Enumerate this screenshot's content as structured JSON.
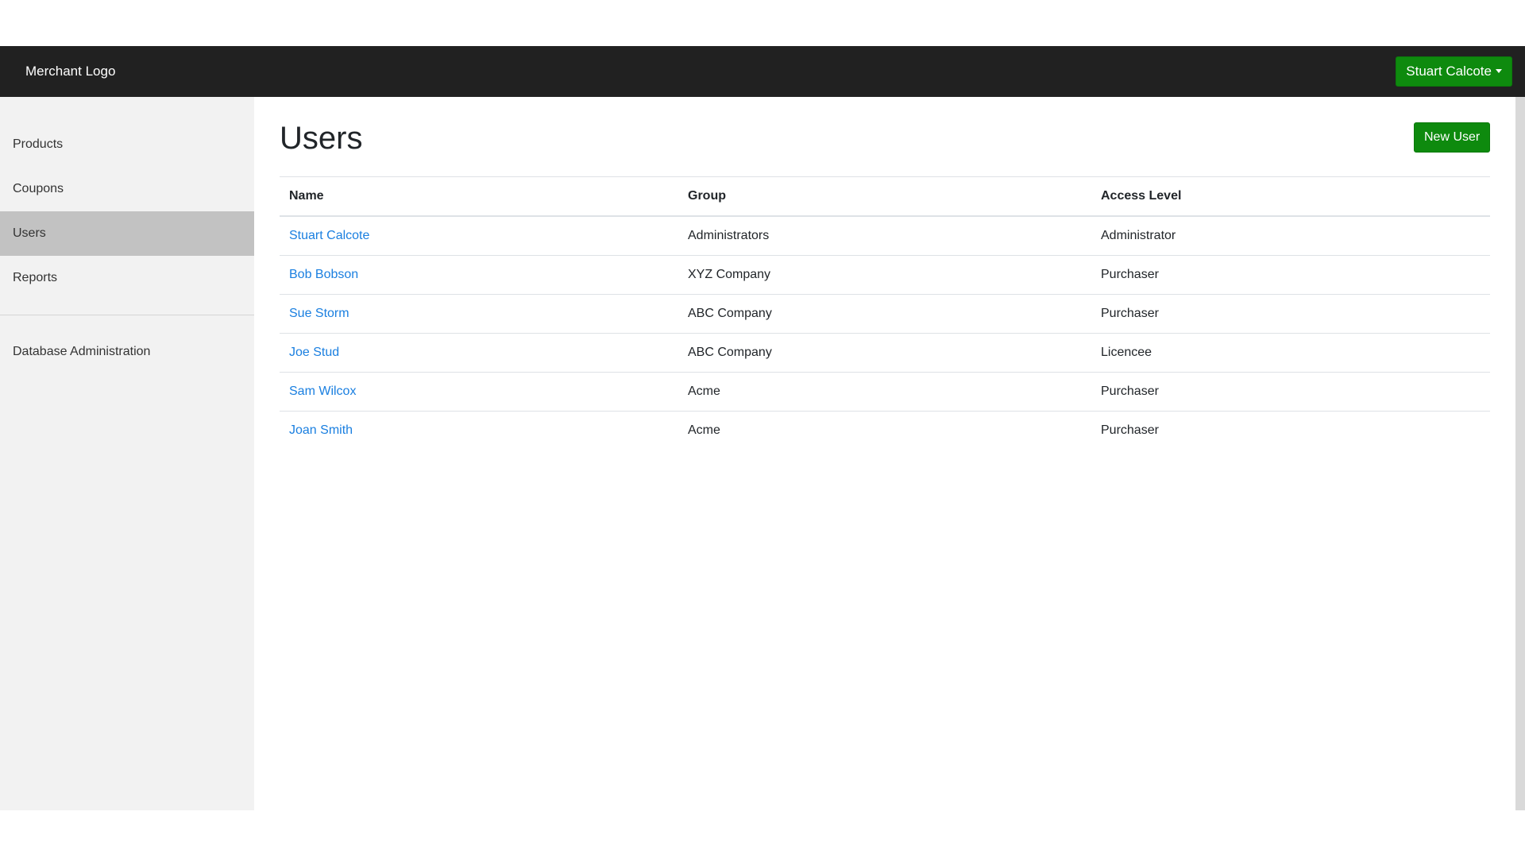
{
  "header": {
    "brand": "Merchant Logo",
    "user_menu_label": "Stuart Calcote"
  },
  "sidebar": {
    "items": [
      {
        "label": "Products",
        "active": false
      },
      {
        "label": "Coupons",
        "active": false
      },
      {
        "label": "Users",
        "active": true
      },
      {
        "label": "Reports",
        "active": false
      }
    ],
    "secondary_items": [
      {
        "label": "Database Administration"
      }
    ]
  },
  "main": {
    "title": "Users",
    "new_user_label": "New User",
    "table": {
      "headers": [
        "Name",
        "Group",
        "Access Level"
      ],
      "rows": [
        {
          "name": "Stuart Calcote",
          "group": "Administrators",
          "access": "Administrator"
        },
        {
          "name": "Bob Bobson",
          "group": "XYZ Company",
          "access": "Purchaser"
        },
        {
          "name": "Sue Storm",
          "group": "ABC Company",
          "access": "Purchaser"
        },
        {
          "name": "Joe Stud",
          "group": "ABC Company",
          "access": "Licencee"
        },
        {
          "name": "Sam Wilcox",
          "group": "Acme",
          "access": "Purchaser"
        },
        {
          "name": "Joan Smith",
          "group": "Acme",
          "access": "Purchaser"
        }
      ]
    }
  },
  "colors": {
    "topbar": "#212121",
    "accent_green": "#0e8a0e",
    "link_blue": "#1a7fe0",
    "sidebar_bg": "#f2f2f2",
    "sidebar_active": "#c2c2c2"
  }
}
